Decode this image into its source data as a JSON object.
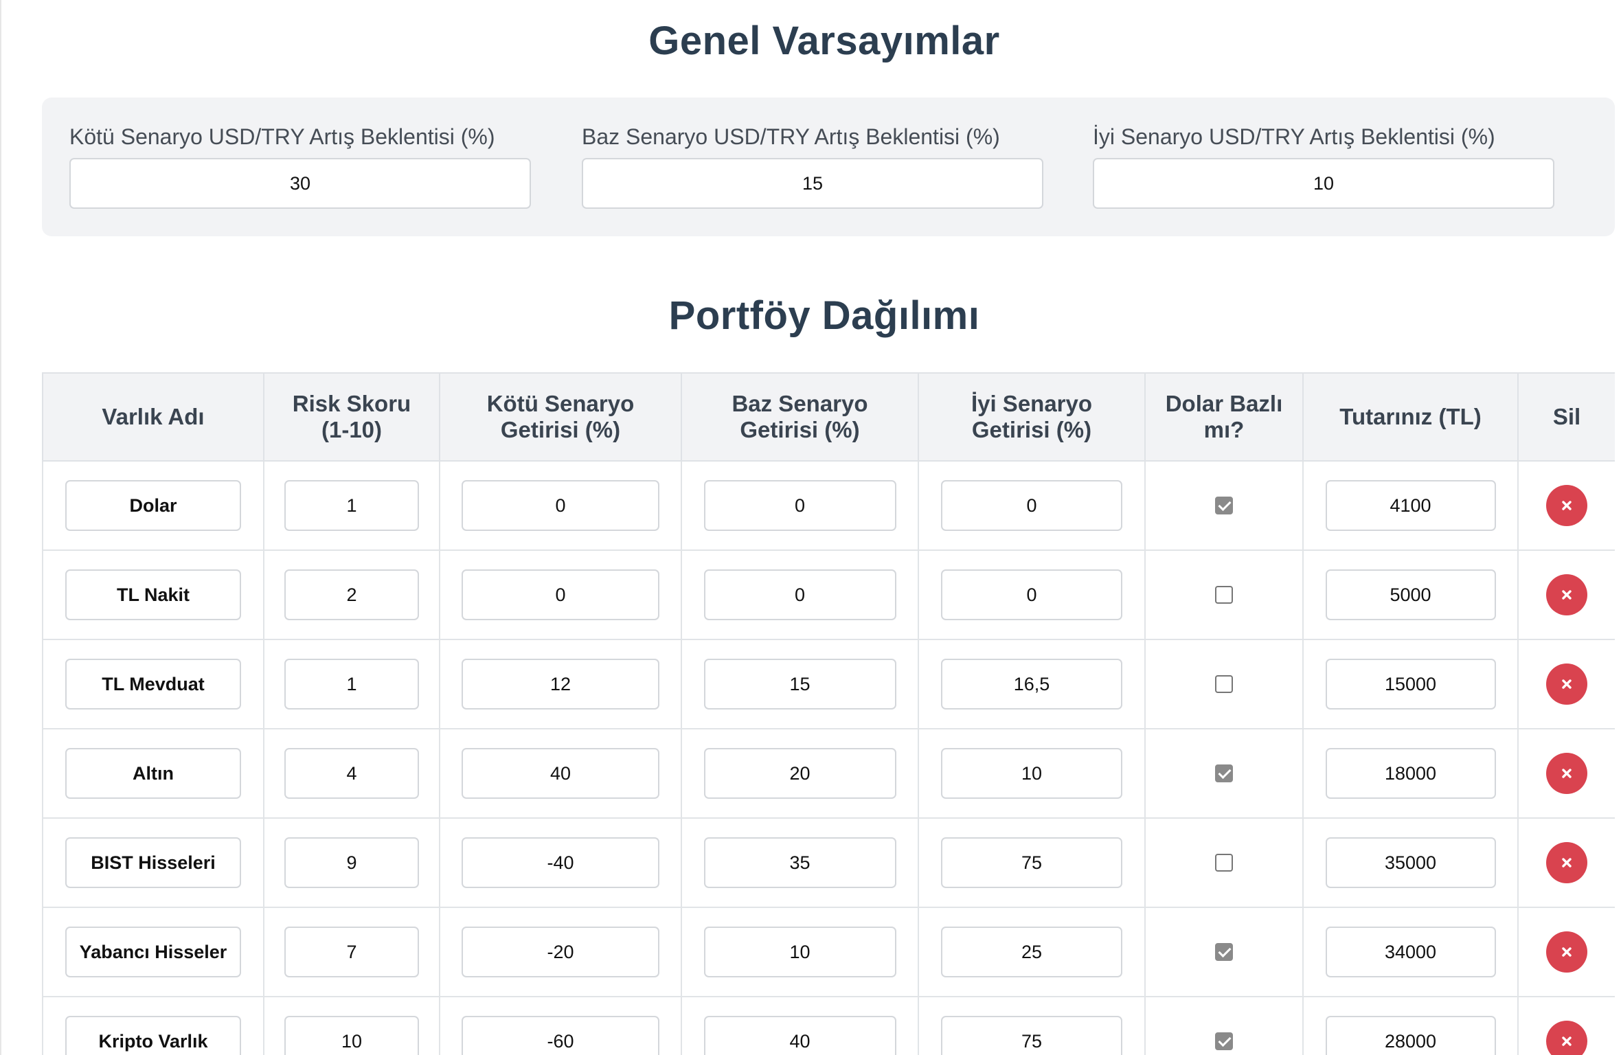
{
  "general": {
    "title": "Genel Varsayımlar",
    "fields": [
      {
        "label": "Kötü Senaryo USD/TRY Artış Beklentisi (%)",
        "value": "30"
      },
      {
        "label": "Baz Senaryo USD/TRY Artış Beklentisi (%)",
        "value": "15"
      },
      {
        "label": "İyi Senaryo USD/TRY Artış Beklentisi (%)",
        "value": "10"
      }
    ]
  },
  "portfolio": {
    "title": "Portföy Dağılımı",
    "headers": {
      "name": "Varlık Adı",
      "risk_l1": "Risk Skoru",
      "risk_l2": "(1-10)",
      "kotu_l1": "Kötü Senaryo",
      "kotu_l2": "Getirisi (%)",
      "baz_l1": "Baz Senaryo",
      "baz_l2": "Getirisi (%)",
      "iyi_l1": "İyi Senaryo",
      "iyi_l2": "Getirisi (%)",
      "dollar_l1": "Dolar Bazlı",
      "dollar_l2": "mı?",
      "amount": "Tutarınız (TL)",
      "delete": "Sil"
    },
    "rows": [
      {
        "name": "Dolar",
        "risk": "1",
        "kotu": "0",
        "baz": "0",
        "iyi": "0",
        "dollar": true,
        "amount": "4100"
      },
      {
        "name": "TL Nakit",
        "risk": "2",
        "kotu": "0",
        "baz": "0",
        "iyi": "0",
        "dollar": false,
        "amount": "5000"
      },
      {
        "name": "TL Mevduat",
        "risk": "1",
        "kotu": "12",
        "baz": "15",
        "iyi": "16,5",
        "dollar": false,
        "amount": "15000"
      },
      {
        "name": "Altın",
        "risk": "4",
        "kotu": "40",
        "baz": "20",
        "iyi": "10",
        "dollar": true,
        "amount": "18000"
      },
      {
        "name": "BIST Hisseleri",
        "risk": "9",
        "kotu": "-40",
        "baz": "35",
        "iyi": "75",
        "dollar": false,
        "amount": "35000"
      },
      {
        "name": "Yabancı Hisseler",
        "risk": "7",
        "kotu": "-20",
        "baz": "10",
        "iyi": "25",
        "dollar": true,
        "amount": "34000"
      },
      {
        "name": "Kripto Varlık",
        "risk": "10",
        "kotu": "-60",
        "baz": "40",
        "iyi": "75",
        "dollar": true,
        "amount": "28000"
      }
    ]
  },
  "icons": {
    "delete": "close-icon",
    "checkbox": "checkbox"
  },
  "colors": {
    "title": "#2c3e50",
    "panel": "#f2f3f5",
    "delete": "#d9434f",
    "checked": "#8a8a8a"
  }
}
